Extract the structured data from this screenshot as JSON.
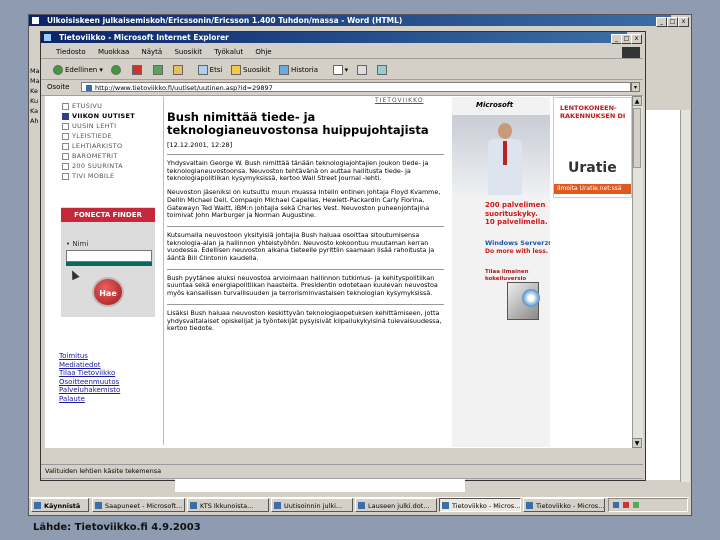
{
  "outer_window": {
    "title": "Ulkoisiskeen julkaisemiskoh/Ericssonin/Ericsson 1.400 Tuhdon/massa - Word (HTML)",
    "left_strip": [
      "Ma",
      "Ma",
      "Ke",
      "Ku",
      "Ka",
      "Ah"
    ]
  },
  "ie": {
    "title": "Tietoviikko - Microsoft Internet Explorer",
    "menu": [
      "Tiedosto",
      "Muokkaa",
      "Näytä",
      "Suosikit",
      "Työkalut",
      "Ohje"
    ],
    "toolbar": {
      "back": "Edellinen",
      "search": "Etsi",
      "favorites": "Suosikit",
      "history": "Historia"
    },
    "address": {
      "label": "Osoite",
      "value": "http://www.tietoviikko.fi/uutiset/uutinen.asp?id=29897"
    },
    "statusbar": "Valituiden lehtien käsite tekemensa"
  },
  "nav": {
    "items": [
      {
        "label": "ETUSIVU",
        "active": false
      },
      {
        "label": "VIIKON UUTISET",
        "active": true
      },
      {
        "label": "UUSIN LEHTI",
        "active": false
      },
      {
        "label": "YLEISTIEDE",
        "active": false
      },
      {
        "label": "LEHTIARKISTO",
        "active": false
      },
      {
        "label": "BAROMETRIT",
        "active": false
      },
      {
        "label": "200 SUURINTA",
        "active": false
      },
      {
        "label": "TIVI MOBILE",
        "active": false
      }
    ],
    "finder_title": "FONECTA FINDER",
    "finder_field": "• Nimi",
    "finder_button": "Hae",
    "links": [
      "Toimitus",
      "Mediatiedot",
      "Tilaa Tietoviikko",
      "Osoitteenmuutos",
      "Palveluhakemisto",
      "Palaute"
    ]
  },
  "article": {
    "topline": "TIETOVIIKKO",
    "headline_1": "Bush nimittää tiede- ja",
    "headline_2": "teknologianeuvostonsa huippujohtajista",
    "date": "[12.12.2001, 12:28]",
    "paragraphs": [
      "Yhdysvaltain George W. Bush nimittää tänään teknologiajohtajien joukon tiede- ja teknologianeuvostoonsa. Neuvoston tehtävänä on auttaa hallitusta tiede- ja teknologiapolitiikan kysymyksissä, kertoo Wall Street Journal -lehti.",
      "Neuvoston jäseniksi on kutsuttu muun muassa Intelin entinen johtaja Floyd Kvamme, Dellin Michael Dell, Compaqin Michael Capellas, Hewlett-Packardin Carly Fiorina, Gatewayn Ted Waitt, IBM:n johtajia sekä Charles Vest. Neuvoston puheenjohtajina toimivat John Marburger ja Norman Augustine.",
      "Kutsumalla neuvostoon yksityisiä johtajia Bush haluaa osoittaa sitoutumisensa teknologia-alan ja hallinnon yhteistyöhön. Neuvosto kokoontuu muutaman kerran vuodessa. Edellisen neuvoston aikana tieteelle pyrittiin saamaan lisää rahoitusta ja ääntä Bill Clintonin kaudella.",
      "Bush pyytänee aluksi neuvostoa arvioimaan hallinnon tutkimus- ja kehityspolitiikan suuntaa sekä energiapolitiikan haasteita. Presidentin odotetaan kuulevan neuvostoa myös kansallisen turvallisuuden ja terrorisminvastaisen teknologian kysymyksissä.",
      "Lisäksi Bush haluaa neuvoston keskittyvän teknologiaopetuksen kehittämiseen, jotta yhdysvaltalaiset opiskelijat ja työntekijät pysyisivät kilpailukykyisinä tulevaisuudessa, kertoo tiedote."
    ]
  },
  "ads": {
    "partner": "Microsoft",
    "lentokone": "LENTOKONEEN- RAKENNUKSEN DI",
    "uratie_logo": "Uratie",
    "uratie_link": "Ilmoita Uratie.net:ssä",
    "suorit_1": "200 palvelimen",
    "suorit_2": "suorituskyky.",
    "suorit_3": "10 palvelimella.",
    "ws_1": "Windows Server",
    "ws_ver": "2003",
    "ws_2": "Do more with less.",
    "trial_1": "Tilaa ilmainen",
    "trial_2": "kokeiluversio"
  },
  "taskbar": [
    {
      "label": "Käynnistä",
      "active": false
    },
    {
      "label": "Saapuneet - Microsoft...",
      "active": false
    },
    {
      "label": "KTS Ikkunoista...",
      "active": false
    },
    {
      "label": "Uutisoinnin julki...",
      "active": false
    },
    {
      "label": "Lauseen julki.dot...",
      "active": false
    },
    {
      "label": "Tietoviikko - Micros...",
      "active": true
    },
    {
      "label": "Tietoviikko - Micros...",
      "active": false
    }
  ],
  "caption": "Lähde: Tietoviikko.fi 4.9.2003",
  "colors": {
    "titlebar": "#0a246a",
    "link": "#1a1aa6",
    "finder": "#c4283a",
    "accent_red": "#d01818"
  }
}
